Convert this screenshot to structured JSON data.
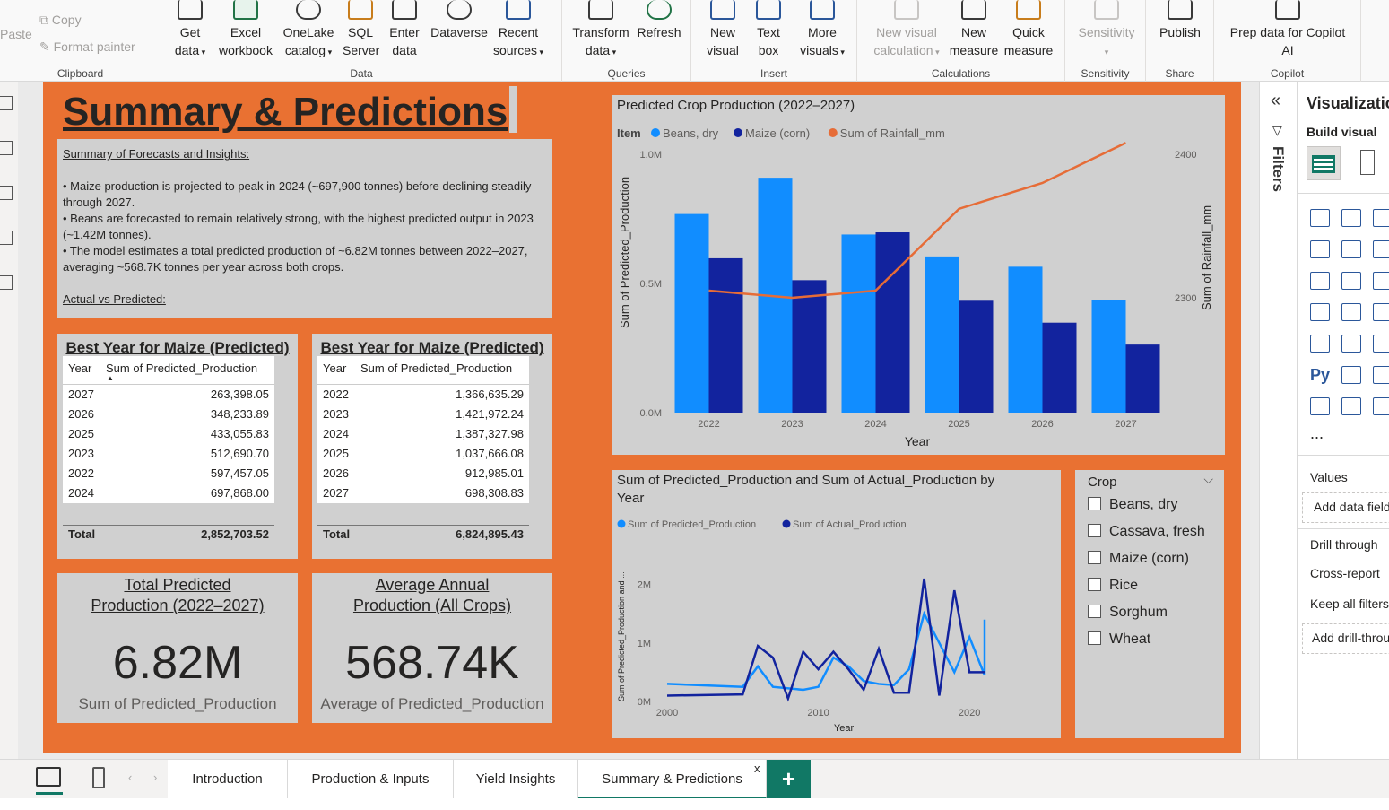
{
  "ribbon": {
    "clipboard": {
      "paste": "Paste",
      "copy": "Copy",
      "format_painter": "Format painter",
      "group": "Clipboard"
    },
    "data": {
      "get_data": [
        "Get",
        "data"
      ],
      "excel": [
        "Excel",
        "workbook"
      ],
      "onelake": [
        "OneLake",
        "catalog"
      ],
      "sql": [
        "SQL",
        "Server"
      ],
      "enter": [
        "Enter",
        "data"
      ],
      "dataverse": "Dataverse",
      "recent": [
        "Recent",
        "sources"
      ],
      "group": "Data"
    },
    "queries": {
      "transform": [
        "Transform",
        "data"
      ],
      "refresh": "Refresh",
      "group": "Queries"
    },
    "insert": {
      "new_visual": [
        "New",
        "visual"
      ],
      "text_box": [
        "Text",
        "box"
      ],
      "more_visuals": [
        "More",
        "visuals"
      ],
      "group": "Insert"
    },
    "calculations": {
      "new_visual_calc": [
        "New visual",
        "calculation"
      ],
      "new_measure": [
        "New",
        "measure"
      ],
      "quick_measure": [
        "Quick",
        "measure"
      ],
      "group": "Calculations"
    },
    "sensitivity": {
      "label": "Sensitivity",
      "group": "Sensitivity"
    },
    "share": {
      "publish": "Publish",
      "group": "Share"
    },
    "copilot": {
      "prep": [
        "Prep data for Copilot",
        "AI"
      ],
      "group": "Copilot"
    }
  },
  "page": {
    "heading": "Summary & Predictions",
    "summary": {
      "heading": "Summary of Forecasts and Insights:",
      "bullets": [
        "• Maize production is projected to peak in 2024 (~697,900 tonnes) before declining steadily through 2027.",
        "• Beans are forecasted to remain relatively strong, with the highest predicted output in 2023 (~1.42M tonnes).",
        "• The model estimates a total predicted production of ~6.82M tonnes between 2022–2027, averaging ~568.7K tonnes per year across both crops."
      ],
      "section2": "Actual vs Predicted:"
    },
    "table1": {
      "title": "Best Year for Maize (Predicted)",
      "col_year": "Year",
      "col_value": "Sum of Predicted_Production",
      "rows": [
        {
          "year": "2027",
          "value": "263,398.05"
        },
        {
          "year": "2026",
          "value": "348,233.89"
        },
        {
          "year": "2025",
          "value": "433,055.83"
        },
        {
          "year": "2023",
          "value": "512,690.70"
        },
        {
          "year": "2022",
          "value": "597,457.05"
        },
        {
          "year": "2024",
          "value": "697,868.00"
        }
      ],
      "total_label": "Total",
      "total_value": "2,852,703.52"
    },
    "table2": {
      "title": "Best Year for Maize (Predicted)",
      "col_year": "Year",
      "col_value": "Sum of Predicted_Production",
      "rows": [
        {
          "year": "2022",
          "value": "1,366,635.29"
        },
        {
          "year": "2023",
          "value": "1,421,972.24"
        },
        {
          "year": "2024",
          "value": "1,387,327.98"
        },
        {
          "year": "2025",
          "value": "1,037,666.08"
        },
        {
          "year": "2026",
          "value": "912,985.01"
        },
        {
          "year": "2027",
          "value": "698,308.83"
        }
      ],
      "total_label": "Total",
      "total_value": "6,824,895.43"
    },
    "kpi1": {
      "title": "Total Predicted Production (2022–2027)",
      "value": "6.82M",
      "sub": "Sum of Predicted_Production"
    },
    "kpi2": {
      "title": "Average Annual Production (All Crops)",
      "value": "568.74K",
      "sub": "Average of Predicted_Production"
    },
    "slicer": {
      "title": "Crop",
      "items": [
        "Beans, dry",
        "Cassava, fresh",
        "Maize (corn)",
        "Rice",
        "Sorghum",
        "Wheat"
      ]
    }
  },
  "chart_data": [
    {
      "type": "bar",
      "title": "Predicted Crop Production (2022–2027)",
      "legend_title": "Item",
      "categories": [
        "2022",
        "2023",
        "2024",
        "2025",
        "2026",
        "2027"
      ],
      "series": [
        {
          "name": "Beans, dry",
          "values": [
            768687,
            909281,
            689460,
            604610,
            564751,
            434911
          ],
          "color": "#118dff"
        },
        {
          "name": "Maize (corn)",
          "values": [
            597457,
            512691,
            697868,
            433056,
            348234,
            263398
          ],
          "color": "#12239e"
        },
        {
          "name": "Sum of Rainfall_mm",
          "values": [
            2305,
            2300,
            2305,
            2362,
            2380,
            2408
          ],
          "color": "#e66c37",
          "axis": "secondary"
        }
      ],
      "xlabel": "Year",
      "ylabel": "Sum of Predicted_Production",
      "y2label": "Sum of Rainfall_mm",
      "ylim": [
        0,
        1000000
      ],
      "yticks": [
        "0.0M",
        "0.5M",
        "1.0M"
      ],
      "y2lim": [
        2220,
        2400
      ],
      "y2ticks": [
        "2300",
        "2400"
      ],
      "legend": "top-left"
    },
    {
      "type": "line",
      "title": "Sum of Predicted_Production and Sum of Actual_Production by Year",
      "series": [
        {
          "name": "Sum of Predicted_Production",
          "color": "#118dff",
          "x": [
            2000,
            2005,
            2006,
            2007,
            2009,
            2010,
            2011,
            2012,
            2013,
            2014,
            2015,
            2016,
            2017,
            2019,
            2020,
            2021,
            2022,
            2023
          ],
          "values": [
            300000,
            250000,
            600000,
            250000,
            200000,
            250000,
            750000,
            600000,
            350000,
            300000,
            280000,
            550000,
            1500000,
            500000,
            1100000,
            450000,
            1400000,
            700000
          ]
        },
        {
          "name": "Sum of Actual_Production",
          "color": "#12239e",
          "x": [
            2000,
            2005,
            2006,
            2007,
            2008,
            2009,
            2010,
            2011,
            2012,
            2013,
            2014,
            2015,
            2016,
            2017,
            2018,
            2019,
            2020,
            2021
          ],
          "values": [
            100000,
            120000,
            950000,
            750000,
            50000,
            850000,
            550000,
            850000,
            550000,
            200000,
            900000,
            150000,
            150000,
            2100000,
            100000,
            1900000,
            500000,
            500000
          ]
        }
      ],
      "xlabel": "Year",
      "ylabel": "Sum of Predicted_Production and ...",
      "xticks": [
        "2000",
        "2010",
        "2020"
      ],
      "yticks": [
        "0M",
        "1M",
        "2M"
      ],
      "ylim": [
        0,
        2300000
      ],
      "xlim": [
        2000,
        2021
      ],
      "legend": "top-left"
    }
  ],
  "viz_pane": {
    "title": "Visualizations",
    "build_visual": "Build visual",
    "filters_label": "Filters",
    "values": "Values",
    "add_data": "Add data fields here",
    "drill_through": "Drill through",
    "cross_report": "Cross-report",
    "keep_filters": "Keep all filters",
    "add_drill": "Add drill-through fields here",
    "more": "..."
  },
  "tabs": {
    "items": [
      "Introduction",
      "Production & Inputs",
      "Yield Insights",
      "Summary & Predictions"
    ],
    "active": "Summary & Predictions",
    "close": "x",
    "add": "+"
  },
  "colors": {
    "canvas": "#e97132",
    "card": "#d0d0d0",
    "accent": "#117865"
  }
}
